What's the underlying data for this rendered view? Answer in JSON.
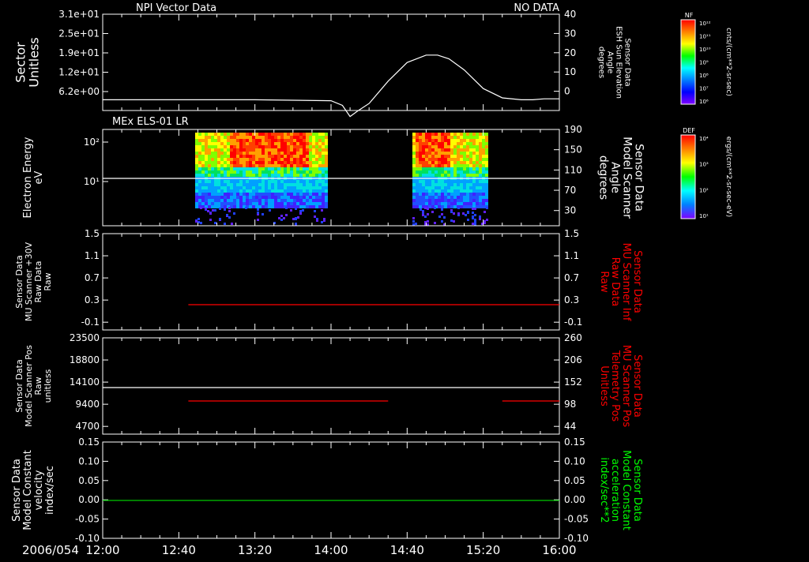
{
  "header": {
    "left_title": "NPI Vector Data",
    "right_status": "NO DATA"
  },
  "colors": {
    "background": "#000000",
    "axis": "#ffffff",
    "trace_white": "#ffffff",
    "trace_red": "#ff0000",
    "trace_green": "#00c800",
    "label_red": "#ff0000",
    "label_green": "#00ff00"
  },
  "x_axis": {
    "date_label": "2006/054",
    "tick_labels": [
      "12:00",
      "12:40",
      "13:20",
      "14:00",
      "14:40",
      "15:20",
      "16:00"
    ],
    "range_minutes": [
      0,
      240
    ]
  },
  "colorbars": [
    {
      "title": "NF",
      "unit_label": "cnts/(cm**2-sr-sec)",
      "tick_labels": [
        "10¹²",
        "10¹¹",
        "10¹⁰",
        "10⁹",
        "10⁸",
        "10⁷",
        "10⁶"
      ]
    },
    {
      "title": "DEF",
      "unit_label": "ergs/(cm**2-sr-sec-eV)",
      "tick_labels": [
        "10⁴",
        "10³",
        "10²",
        "10¹"
      ]
    }
  ],
  "chart_data": [
    {
      "type": "line",
      "panel": 1,
      "left_axis_label": [
        "Sector",
        "Unitless"
      ],
      "left_tick_labels": [
        "3.1e+01",
        "2.5e+01",
        "1.9e+01",
        "1.2e+01",
        "6.2e+00"
      ],
      "right_axis_label": [
        "Sensor Data",
        "ESH Sun Elevation",
        "Angle",
        "degrees"
      ],
      "right_tick_labels": [
        "40",
        "30",
        "20",
        "10",
        "0"
      ],
      "ylim": [
        -10,
        40
      ],
      "series": [
        {
          "axis": "right",
          "color": "trace_white",
          "x_minutes": [
            0,
            40,
            80,
            120,
            126,
            130,
            134,
            140,
            150,
            160,
            170,
            176,
            182,
            190,
            200,
            210,
            220,
            226,
            232,
            240
          ],
          "values": [
            0,
            0,
            0,
            -0.5,
            -3,
            -9,
            -6,
            -2,
            10,
            20,
            24,
            24,
            22,
            16,
            6,
            1,
            0,
            0,
            0.5,
            0.5
          ]
        }
      ]
    },
    {
      "type": "heatmap",
      "panel": 2,
      "title": "MEx ELS-01 LR",
      "left_axis_label": [
        "Electron Energy",
        "eV"
      ],
      "left_tick_labels": [
        "10²",
        "10¹"
      ],
      "right_axis_label": [
        "Sensor Data",
        "Model Scanner",
        "Angle",
        "degrees"
      ],
      "right_tick_labels": [
        "190",
        "150",
        "110",
        "70",
        "30"
      ],
      "ylim": [
        0,
        190
      ],
      "data_blocks_minutes": [
        [
          52,
          158
        ],
        [
          218,
          276
        ]
      ],
      "hot_regions_minutes": [
        [
          80,
          140
        ],
        [
          226,
          252
        ]
      ],
      "series": [
        {
          "axis": "right",
          "color": "trace_white",
          "x_minutes": [
            0,
            240
          ],
          "values": [
            90,
            90
          ]
        }
      ]
    },
    {
      "type": "line",
      "panel": 3,
      "left_axis_label": [
        "Sensor Data",
        "MU Scanner +30V",
        "Raw Data",
        "Raw"
      ],
      "left_tick_labels": [
        "1.5",
        "1.1",
        "0.7",
        "0.3",
        "-0.1"
      ],
      "right_axis_label": [
        "Sensor Data",
        "MU Scanner Inf",
        "Raw Data",
        "Raw"
      ],
      "right_tick_labels": [
        "1.5",
        "1.1",
        "0.7",
        "0.3",
        "-0.1"
      ],
      "ylim": [
        -0.5,
        1.5
      ],
      "series": [
        {
          "axis": "right",
          "color": "trace_red",
          "x_minutes": [
            45,
            240
          ],
          "values": [
            0.0,
            0.0
          ]
        }
      ]
    },
    {
      "type": "line",
      "panel": 4,
      "left_axis_label": [
        "Sensor Data",
        "Model Scanner Pos",
        "Raw",
        "unitless"
      ],
      "left_tick_labels": [
        "23500",
        "18800",
        "14100",
        "9400",
        "4700"
      ],
      "right_axis_label": [
        "Sensor Data",
        "MU Scanner Pos",
        "Telemetry Pos",
        "Unitless"
      ],
      "right_tick_labels": [
        "260",
        "206",
        "152",
        "98",
        "44"
      ],
      "ylim_left": [
        0,
        23500
      ],
      "series": [
        {
          "axis": "left",
          "color": "trace_white",
          "x_minutes": [
            0,
            240
          ],
          "values": [
            11650,
            11650
          ]
        },
        {
          "axis": "left",
          "color": "trace_red",
          "x_minutes": [
            45,
            150
          ],
          "values": [
            8100,
            8100
          ]
        },
        {
          "axis": "left",
          "color": "trace_red",
          "x_minutes": [
            210,
            240
          ],
          "values": [
            8100,
            8100
          ]
        }
      ]
    },
    {
      "type": "line",
      "panel": 5,
      "left_axis_label": [
        "Sensor Data",
        "Model Constant",
        "velocity",
        "index/sec"
      ],
      "left_tick_labels": [
        "0.15",
        "0.10",
        "0.05",
        "0.00",
        "-0.05",
        "-0.10"
      ],
      "right_axis_label": [
        "Sensor Data",
        "Model Constant",
        "acceleration",
        "index/sec**2"
      ],
      "right_tick_labels": [
        "0.15",
        "0.10",
        "0.05",
        "0.00",
        "-0.05",
        "-0.10"
      ],
      "ylim": [
        -0.1,
        0.15
      ],
      "series": [
        {
          "axis": "left",
          "color": "trace_green",
          "x_minutes": [
            0,
            240
          ],
          "values": [
            0.0,
            0.0
          ]
        }
      ]
    }
  ]
}
